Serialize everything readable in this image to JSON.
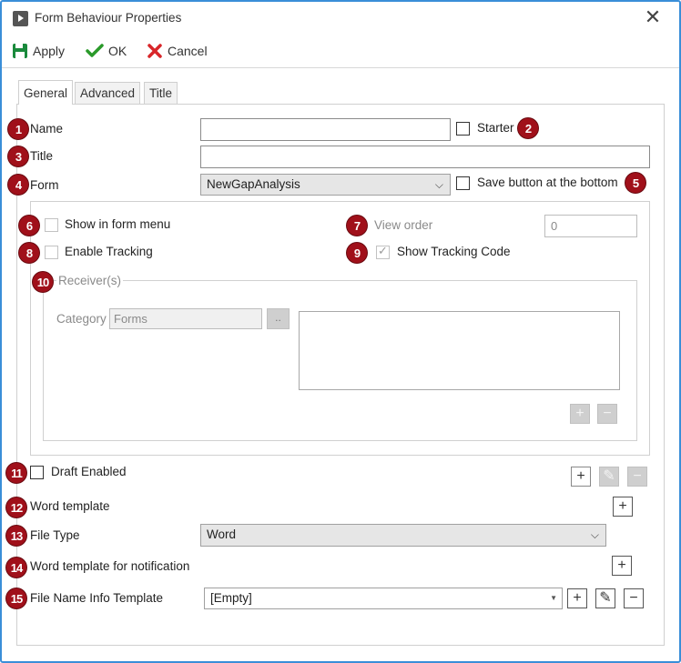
{
  "window": {
    "title": "Form Behaviour Properties"
  },
  "toolbar": {
    "apply_label": "Apply",
    "ok_label": "OK",
    "cancel_label": "Cancel"
  },
  "tabs": [
    {
      "label": "General"
    },
    {
      "label": "Advanced"
    },
    {
      "label": "Title"
    }
  ],
  "fields": {
    "name_label": "Name",
    "starter_label": "Starter",
    "title_label": "Title",
    "form_label": "Form",
    "form_value": "NewGapAnalysis",
    "save_bottom_label": "Save button at the bottom",
    "show_menu_label": "Show in form menu",
    "view_order_label": "View order",
    "view_order_value": "0",
    "enable_tracking_label": "Enable Tracking",
    "show_tracking_label": "Show Tracking Code",
    "receivers_label": "Receiver(s)",
    "category_label": "Category",
    "category_value": "Forms",
    "category_browse": "..",
    "draft_label": "Draft Enabled",
    "word_template_label": "Word template",
    "file_type_label": "File Type",
    "file_type_value": "Word",
    "word_notification_label": "Word template for notification",
    "file_name_label": "File Name Info Template",
    "file_name_value": "[Empty]"
  },
  "badges": [
    "1",
    "2",
    "3",
    "4",
    "5",
    "6",
    "7",
    "8",
    "9",
    "10",
    "11",
    "12",
    "13",
    "14",
    "15"
  ],
  "colors": {
    "badge": "#a0101a",
    "window_border": "#3a8ed8",
    "save_icon": "#1a8a3c",
    "ok_icon": "#2a9a2a",
    "cancel_icon": "#d8262a"
  },
  "icons": {
    "title": "play-icon",
    "apply": "floppy-disk-icon",
    "ok": "checkmark-icon",
    "cancel": "x-icon"
  }
}
